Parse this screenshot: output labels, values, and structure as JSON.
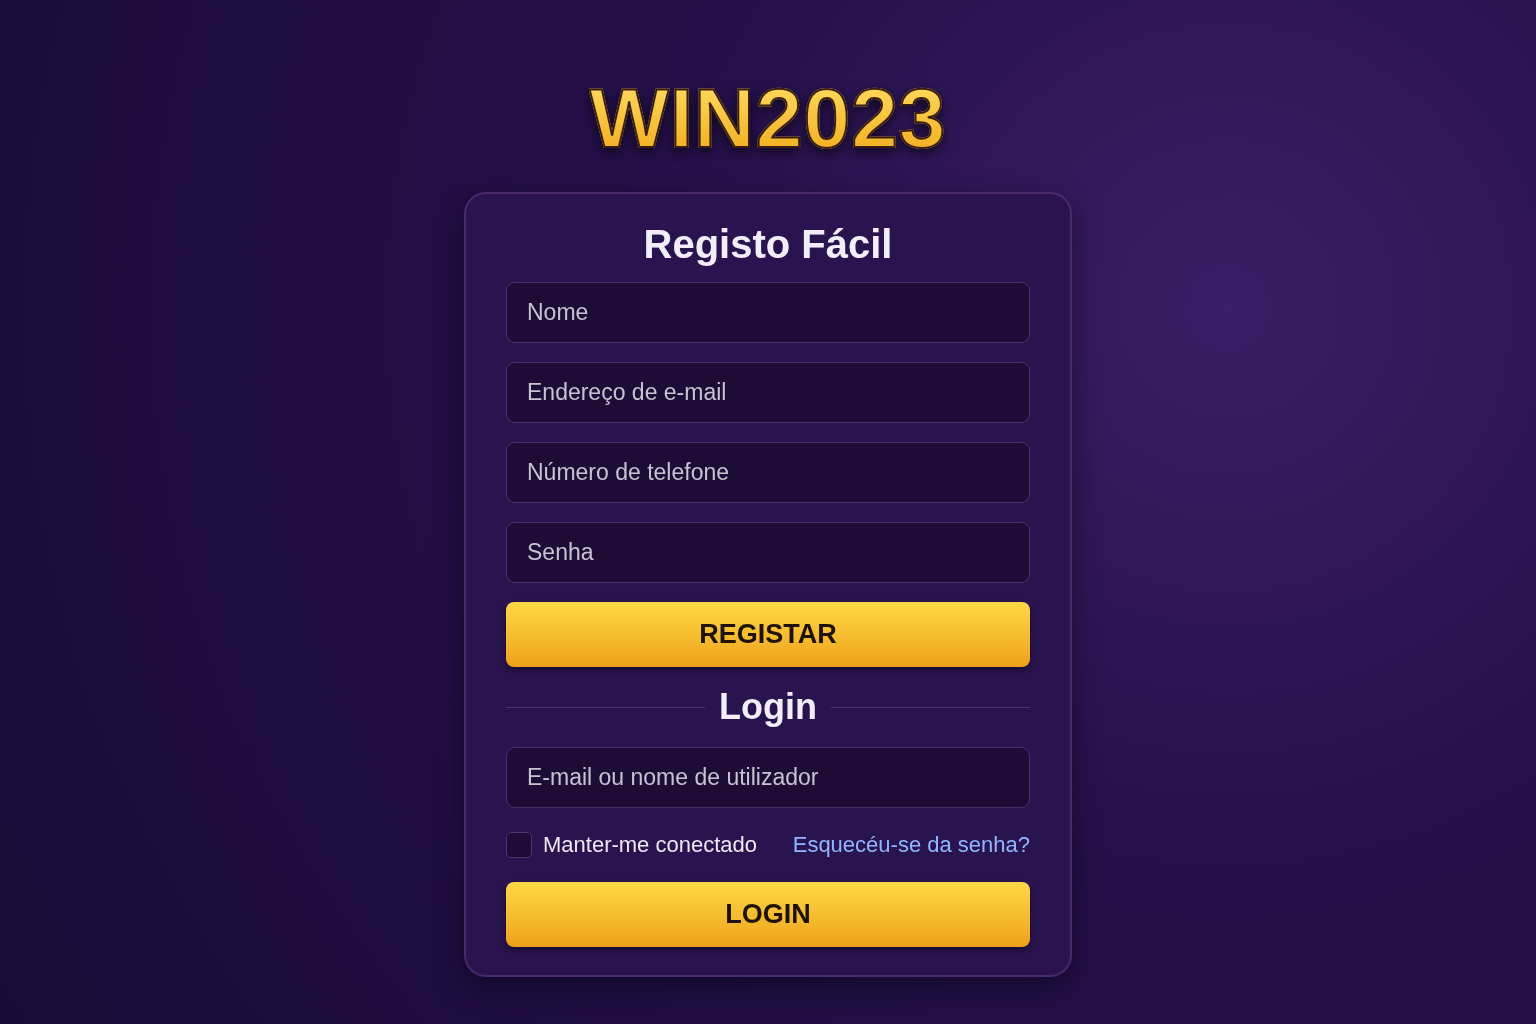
{
  "logo": "WIN2023",
  "register": {
    "title": "Registo Fácil",
    "fields": [
      {
        "placeholder": "Nome"
      },
      {
        "placeholder": "Endereço de e-mail"
      },
      {
        "placeholder": "Número de telefone"
      },
      {
        "placeholder": "Senha"
      }
    ],
    "button": "REGISTAR"
  },
  "login": {
    "title": "Login",
    "fields": [
      {
        "placeholder": "E-mail ou nome de utilizador"
      }
    ],
    "remember": {
      "label": "Manter-me conectado",
      "checked": false
    },
    "forgot_link": "Esquecéu-se da senha?",
    "button": "LOGIN"
  }
}
